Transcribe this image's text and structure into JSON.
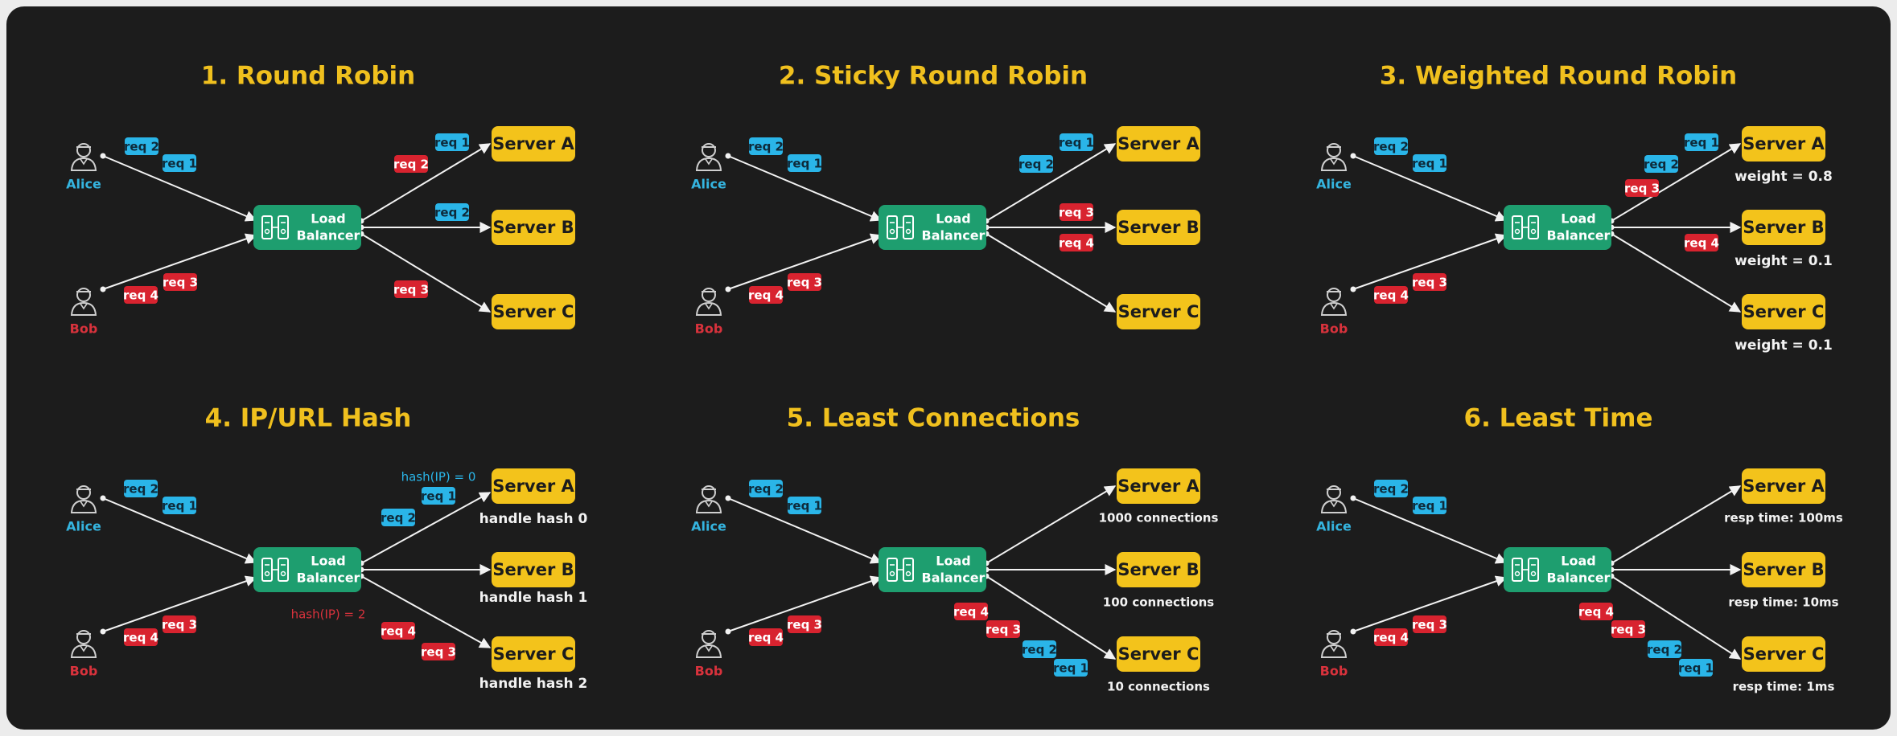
{
  "colors": {
    "background": "#1c1c1c",
    "title": "#f0c01e",
    "server_fill": "#f3c31b",
    "server_text": "#1c1c1c",
    "load_balancer": "#1e9e6f",
    "req_blue": "#2ab5e8",
    "req_red": "#d8232f",
    "alice": "#35b5e0",
    "bob": "#d8323c",
    "arrow": "#f2f2f2",
    "note": "#f2f2f2"
  },
  "icons": {
    "client": "user-icon",
    "balancer": "server-rack-icon"
  },
  "panels": [
    {
      "title": "1. Round Robin",
      "clients": [
        "Alice",
        "Bob"
      ],
      "balancer": [
        "Load",
        "Balancer"
      ],
      "servers": [
        "Server A",
        "Server B",
        "Server C"
      ],
      "server_notes": [],
      "tags": [
        {
          "text": "req 2",
          "color": "blue"
        },
        {
          "text": "req 1",
          "color": "blue"
        },
        {
          "text": "req 4",
          "color": "red"
        },
        {
          "text": "req 3",
          "color": "red"
        },
        {
          "text": "req 1",
          "color": "blue"
        },
        {
          "text": "req 2",
          "color": "red"
        },
        {
          "text": "req 2",
          "color": "blue"
        },
        {
          "text": "req 3",
          "color": "red"
        }
      ],
      "hash_labels": []
    },
    {
      "title": "2. Sticky Round Robin",
      "clients": [
        "Alice",
        "Bob"
      ],
      "balancer": [
        "Load",
        "Balancer"
      ],
      "servers": [
        "Server A",
        "Server B",
        "Server C"
      ],
      "server_notes": [],
      "tags": [
        {
          "text": "req 2",
          "color": "blue"
        },
        {
          "text": "req 1",
          "color": "blue"
        },
        {
          "text": "req 4",
          "color": "red"
        },
        {
          "text": "req 3",
          "color": "red"
        },
        {
          "text": "req 1",
          "color": "blue"
        },
        {
          "text": "req 2",
          "color": "blue"
        },
        {
          "text": "req 3",
          "color": "red"
        },
        {
          "text": "req 4",
          "color": "red"
        }
      ],
      "hash_labels": []
    },
    {
      "title": "3. Weighted Round Robin",
      "clients": [
        "Alice",
        "Bob"
      ],
      "balancer": [
        "Load",
        "Balancer"
      ],
      "servers": [
        "Server A",
        "Server B",
        "Server C"
      ],
      "server_notes": [
        "weight = 0.8",
        "weight = 0.1",
        "weight = 0.1"
      ],
      "tags": [
        {
          "text": "req 2",
          "color": "blue"
        },
        {
          "text": "req 1",
          "color": "blue"
        },
        {
          "text": "req 4",
          "color": "red"
        },
        {
          "text": "req 3",
          "color": "red"
        },
        {
          "text": "req 1",
          "color": "blue"
        },
        {
          "text": "req 2",
          "color": "blue"
        },
        {
          "text": "req 3",
          "color": "red"
        },
        {
          "text": "req 4",
          "color": "red"
        }
      ],
      "hash_labels": []
    },
    {
      "title": "4. IP/URL Hash",
      "clients": [
        "Alice",
        "Bob"
      ],
      "balancer": [
        "Load",
        "Balancer"
      ],
      "servers": [
        "Server A",
        "Server B",
        "Server C"
      ],
      "server_notes": [
        "handle hash 0",
        "handle hash 1",
        "handle hash 2"
      ],
      "tags": [
        {
          "text": "req 2",
          "color": "blue"
        },
        {
          "text": "req 1",
          "color": "blue"
        },
        {
          "text": "req 4",
          "color": "red"
        },
        {
          "text": "req 3",
          "color": "red"
        },
        {
          "text": "req 1",
          "color": "blue"
        },
        {
          "text": "req 2",
          "color": "blue"
        },
        {
          "text": "req 4",
          "color": "red"
        },
        {
          "text": "req 3",
          "color": "red"
        }
      ],
      "hash_labels": [
        {
          "text": "hash(IP) = 0",
          "color": "blue"
        },
        {
          "text": "hash(IP) = 2",
          "color": "red"
        }
      ]
    },
    {
      "title": "5. Least Connections",
      "clients": [
        "Alice",
        "Bob"
      ],
      "balancer": [
        "Load",
        "Balancer"
      ],
      "servers": [
        "Server A",
        "Server B",
        "Server C"
      ],
      "server_notes": [
        "1000 connections",
        "100 connections",
        "10 connections"
      ],
      "tags": [
        {
          "text": "req 2",
          "color": "blue"
        },
        {
          "text": "req 1",
          "color": "blue"
        },
        {
          "text": "req 4",
          "color": "red"
        },
        {
          "text": "req 3",
          "color": "red"
        },
        {
          "text": "req 4",
          "color": "red"
        },
        {
          "text": "req 3",
          "color": "red"
        },
        {
          "text": "req 2",
          "color": "blue"
        },
        {
          "text": "req 1",
          "color": "blue"
        }
      ],
      "hash_labels": []
    },
    {
      "title": "6. Least Time",
      "clients": [
        "Alice",
        "Bob"
      ],
      "balancer": [
        "Load",
        "Balancer"
      ],
      "servers": [
        "Server A",
        "Server B",
        "Server C"
      ],
      "server_notes": [
        "resp time: 100ms",
        "resp time: 10ms",
        "resp time: 1ms"
      ],
      "tags": [
        {
          "text": "req 2",
          "color": "blue"
        },
        {
          "text": "req 1",
          "color": "blue"
        },
        {
          "text": "req 4",
          "color": "red"
        },
        {
          "text": "req 3",
          "color": "red"
        },
        {
          "text": "req 4",
          "color": "red"
        },
        {
          "text": "req 3",
          "color": "red"
        },
        {
          "text": "req 2",
          "color": "blue"
        },
        {
          "text": "req 1",
          "color": "blue"
        }
      ],
      "hash_labels": []
    }
  ]
}
